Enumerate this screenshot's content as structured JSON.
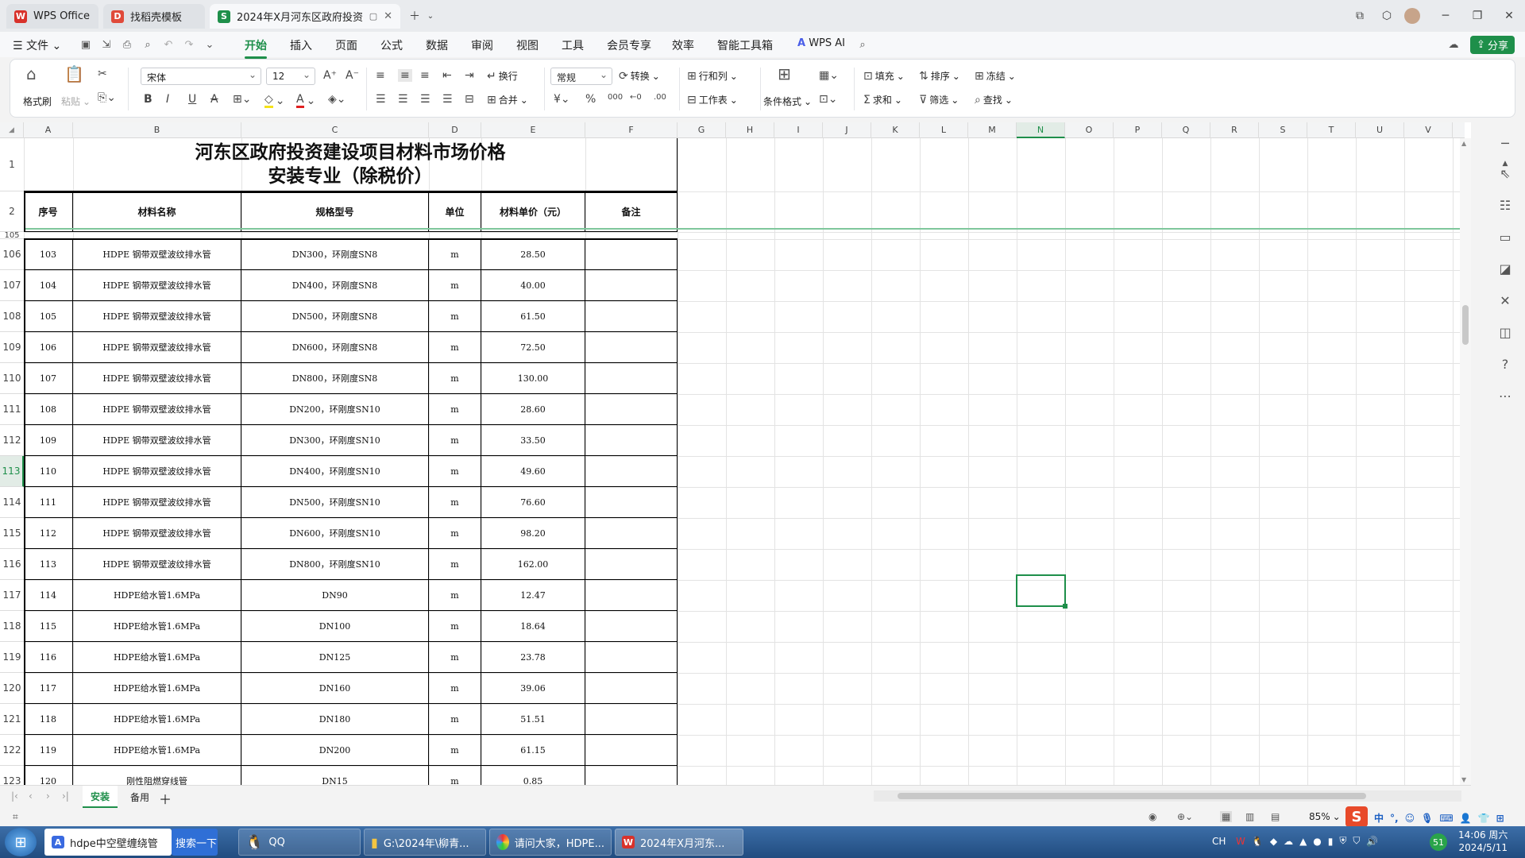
{
  "tabs": [
    {
      "label": "WPS Office",
      "icon": "W"
    },
    {
      "label": "找稻壳模板",
      "icon": "D"
    },
    {
      "label": "2024年X月河东区政府投资建",
      "icon": "S"
    }
  ],
  "menu": {
    "file": "文件",
    "tabs": [
      "开始",
      "插入",
      "页面",
      "公式",
      "数据",
      "审阅",
      "视图",
      "工具",
      "会员专享",
      "效率",
      "智能工具箱"
    ],
    "active": "开始",
    "ai": "WPS AI",
    "share": "分享"
  },
  "ribbon": {
    "format_painter": "格式刷",
    "paste": "粘贴",
    "font": "宋体",
    "size": "12",
    "wrap": "换行",
    "number_format": "常规",
    "convert": "转换",
    "row_col": "行和列",
    "worksheet": "工作表",
    "cond_format": "条件格式",
    "merge": "合并",
    "fill": "填充",
    "sort": "排序",
    "freeze": "冻结",
    "sum": "求和",
    "filter": "筛选",
    "find": "查找"
  },
  "columns": [
    "A",
    "B",
    "C",
    "D",
    "E",
    "F",
    "G",
    "H",
    "I",
    "J",
    "K",
    "L",
    "M",
    "N",
    "O",
    "P",
    "Q",
    "R",
    "S",
    "T",
    "U",
    "V"
  ],
  "title_line1": "河东区政府投资建设项目材料市场价格",
  "title_line2": "安装专业（除税价）",
  "headers": [
    "序号",
    "材料名称",
    "规格型号",
    "单位",
    "材料单价（元）",
    "备注"
  ],
  "rows": [
    {
      "r": "106",
      "n": "103",
      "name": "HDPE 钢带双壁波纹排水管",
      "spec": "DN300，环刚度SN8",
      "unit": "m",
      "price": "28.50"
    },
    {
      "r": "107",
      "n": "104",
      "name": "HDPE 钢带双壁波纹排水管",
      "spec": "DN400，环刚度SN8",
      "unit": "m",
      "price": "40.00"
    },
    {
      "r": "108",
      "n": "105",
      "name": "HDPE 钢带双壁波纹排水管",
      "spec": "DN500，环刚度SN8",
      "unit": "m",
      "price": "61.50"
    },
    {
      "r": "109",
      "n": "106",
      "name": "HDPE 钢带双壁波纹排水管",
      "spec": "DN600，环刚度SN8",
      "unit": "m",
      "price": "72.50"
    },
    {
      "r": "110",
      "n": "107",
      "name": "HDPE 钢带双壁波纹排水管",
      "spec": "DN800，环刚度SN8",
      "unit": "m",
      "price": "130.00"
    },
    {
      "r": "111",
      "n": "108",
      "name": "HDPE 钢带双壁波纹排水管",
      "spec": "DN200，环刚度SN10",
      "unit": "m",
      "price": "28.60"
    },
    {
      "r": "112",
      "n": "109",
      "name": "HDPE 钢带双壁波纹排水管",
      "spec": "DN300，环刚度SN10",
      "unit": "m",
      "price": "33.50"
    },
    {
      "r": "113",
      "n": "110",
      "name": "HDPE 钢带双壁波纹排水管",
      "spec": "DN400，环刚度SN10",
      "unit": "m",
      "price": "49.60"
    },
    {
      "r": "114",
      "n": "111",
      "name": "HDPE 钢带双壁波纹排水管",
      "spec": "DN500，环刚度SN10",
      "unit": "m",
      "price": "76.60"
    },
    {
      "r": "115",
      "n": "112",
      "name": "HDPE 钢带双壁波纹排水管",
      "spec": "DN600，环刚度SN10",
      "unit": "m",
      "price": "98.20"
    },
    {
      "r": "116",
      "n": "113",
      "name": "HDPE 钢带双壁波纹排水管",
      "spec": "DN800，环刚度SN10",
      "unit": "m",
      "price": "162.00"
    },
    {
      "r": "117",
      "n": "114",
      "name": "HDPE给水管1.6MPa",
      "spec": "DN90",
      "unit": "m",
      "price": "12.47"
    },
    {
      "r": "118",
      "n": "115",
      "name": "HDPE给水管1.6MPa",
      "spec": "DN100",
      "unit": "m",
      "price": "18.64"
    },
    {
      "r": "119",
      "n": "116",
      "name": "HDPE给水管1.6MPa",
      "spec": "DN125",
      "unit": "m",
      "price": "23.78"
    },
    {
      "r": "120",
      "n": "117",
      "name": "HDPE给水管1.6MPa",
      "spec": "DN160",
      "unit": "m",
      "price": "39.06"
    },
    {
      "r": "121",
      "n": "118",
      "name": "HDPE给水管1.6MPa",
      "spec": "DN180",
      "unit": "m",
      "price": "51.51"
    },
    {
      "r": "122",
      "n": "119",
      "name": "HDPE给水管1.6MPa",
      "spec": "DN200",
      "unit": "m",
      "price": "61.15"
    },
    {
      "r": "123",
      "n": "120",
      "name": "刚性阻燃穿线管",
      "spec": "DN15",
      "unit": "m",
      "price": "0.85"
    }
  ],
  "selected_cell": "N113",
  "sheets": [
    "安装",
    "备用"
  ],
  "active_sheet": "安装",
  "status": {
    "zoom": "85%"
  },
  "taskbar": {
    "items": [
      "hdpe中空壁缠绕管",
      "搜索一下",
      "QQ",
      "G:\\2024年\\柳青...",
      "请问大家，HDPE...",
      "2024年X月河东..."
    ],
    "lang": "CH",
    "time": "14:06 周六",
    "date": "2024/5/11",
    "badge": "51"
  }
}
